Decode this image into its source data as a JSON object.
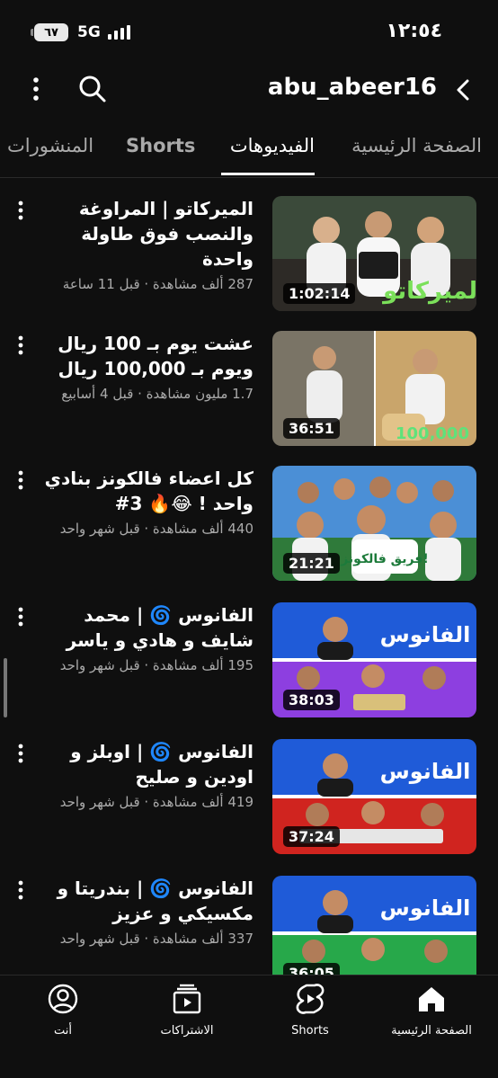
{
  "status_bar": {
    "time": "١٢:٥٤",
    "battery": "٦٧",
    "network": "5G"
  },
  "header": {
    "title": "abu_abeer16"
  },
  "tabs": [
    {
      "label": "الصفحة الرئيسية",
      "active": false
    },
    {
      "label": "الفيديوهات",
      "active": true
    },
    {
      "label": "Shorts",
      "active": false
    },
    {
      "label": "المنشورات",
      "active": false
    }
  ],
  "videos": [
    {
      "title": "الميركاتو | المراوغة والنصب فوق طاولة واحدة",
      "meta": "287 ألف مشاهدة · قبل 11 ساعة",
      "duration": "1:02:14",
      "thumb_text": "الميركاتو",
      "colors": [
        "#3b4a3a",
        "#1e6b3c"
      ]
    },
    {
      "title": "عشت يوم بـ 100 ريال ويوم بـ 100,000 ريال",
      "meta": "1.7 مليون مشاهدة · قبل 4 أسابيع",
      "duration": "36:51",
      "thumb_text": "100,000",
      "colors": [
        "#7a7466",
        "#c9a56b"
      ]
    },
    {
      "title": "كل اعضاء فالكونز بنادي واحد ! 😂🔥 3#",
      "meta": "440 ألف مشاهدة · قبل شهر واحد",
      "duration": "21:21",
      "thumb_text": "فريق فالكونز!",
      "colors": [
        "#4b8fd6",
        "#2f7a3a"
      ]
    },
    {
      "title": "الفانوس 🌀 | محمد شايف و هادي و ياسر",
      "meta": "195 ألف مشاهدة · قبل شهر واحد",
      "duration": "38:03",
      "thumb_text": "الفانوس",
      "colors": [
        "#1f5bd8",
        "#8d3fe0"
      ]
    },
    {
      "title": "الفانوس 🌀 | اوبلز و اودين و صليح",
      "meta": "419 ألف مشاهدة · قبل شهر واحد",
      "duration": "37:24",
      "thumb_text": "الفانوس",
      "colors": [
        "#1f5bd8",
        "#d0241f"
      ]
    },
    {
      "title": "الفانوس 🌀 | بندريتا و مكسيكي و عزيز",
      "meta": "337 ألف مشاهدة · قبل شهر واحد",
      "duration": "36:05",
      "thumb_text": "الفانوس",
      "colors": [
        "#1f5bd8",
        "#27a84a"
      ]
    }
  ],
  "bottom_nav": [
    {
      "label": "الصفحة الرئيسية",
      "icon": "home-icon"
    },
    {
      "label": "Shorts",
      "icon": "shorts-icon"
    },
    {
      "label": "الاشتراكات",
      "icon": "subscriptions-icon"
    },
    {
      "label": "أنت",
      "icon": "account-icon"
    }
  ]
}
